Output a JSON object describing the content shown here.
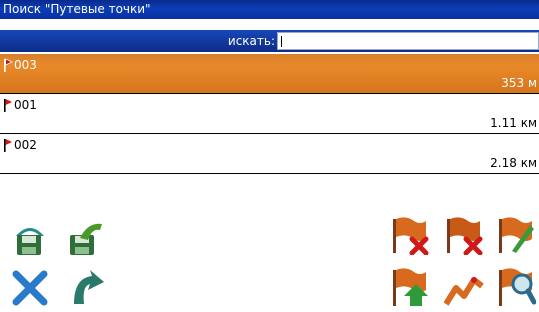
{
  "window": {
    "title": "Поиск \"Путевые точки\""
  },
  "search": {
    "label": "искать:",
    "value": ""
  },
  "waypoints": [
    {
      "name": "003",
      "distance": "353 м",
      "selected": true
    },
    {
      "name": "001",
      "distance": "1.11 км",
      "selected": false
    },
    {
      "name": "002",
      "distance": "2.18 км",
      "selected": false
    }
  ],
  "toolbar": {
    "left": [
      "house-save-icon",
      "house-open-icon",
      "close-x-icon",
      "back-arrow-icon"
    ],
    "right": [
      "flag-delete-icon",
      "flag-delete-all-icon",
      "flag-edit-icon",
      "flag-upload-icon",
      "route-icon",
      "flag-search-icon"
    ]
  },
  "colors": {
    "title_bar": "#0b3fb6",
    "selection": "#e8892a",
    "accent_green": "#2e8b3a",
    "accent_red": "#d01818"
  }
}
